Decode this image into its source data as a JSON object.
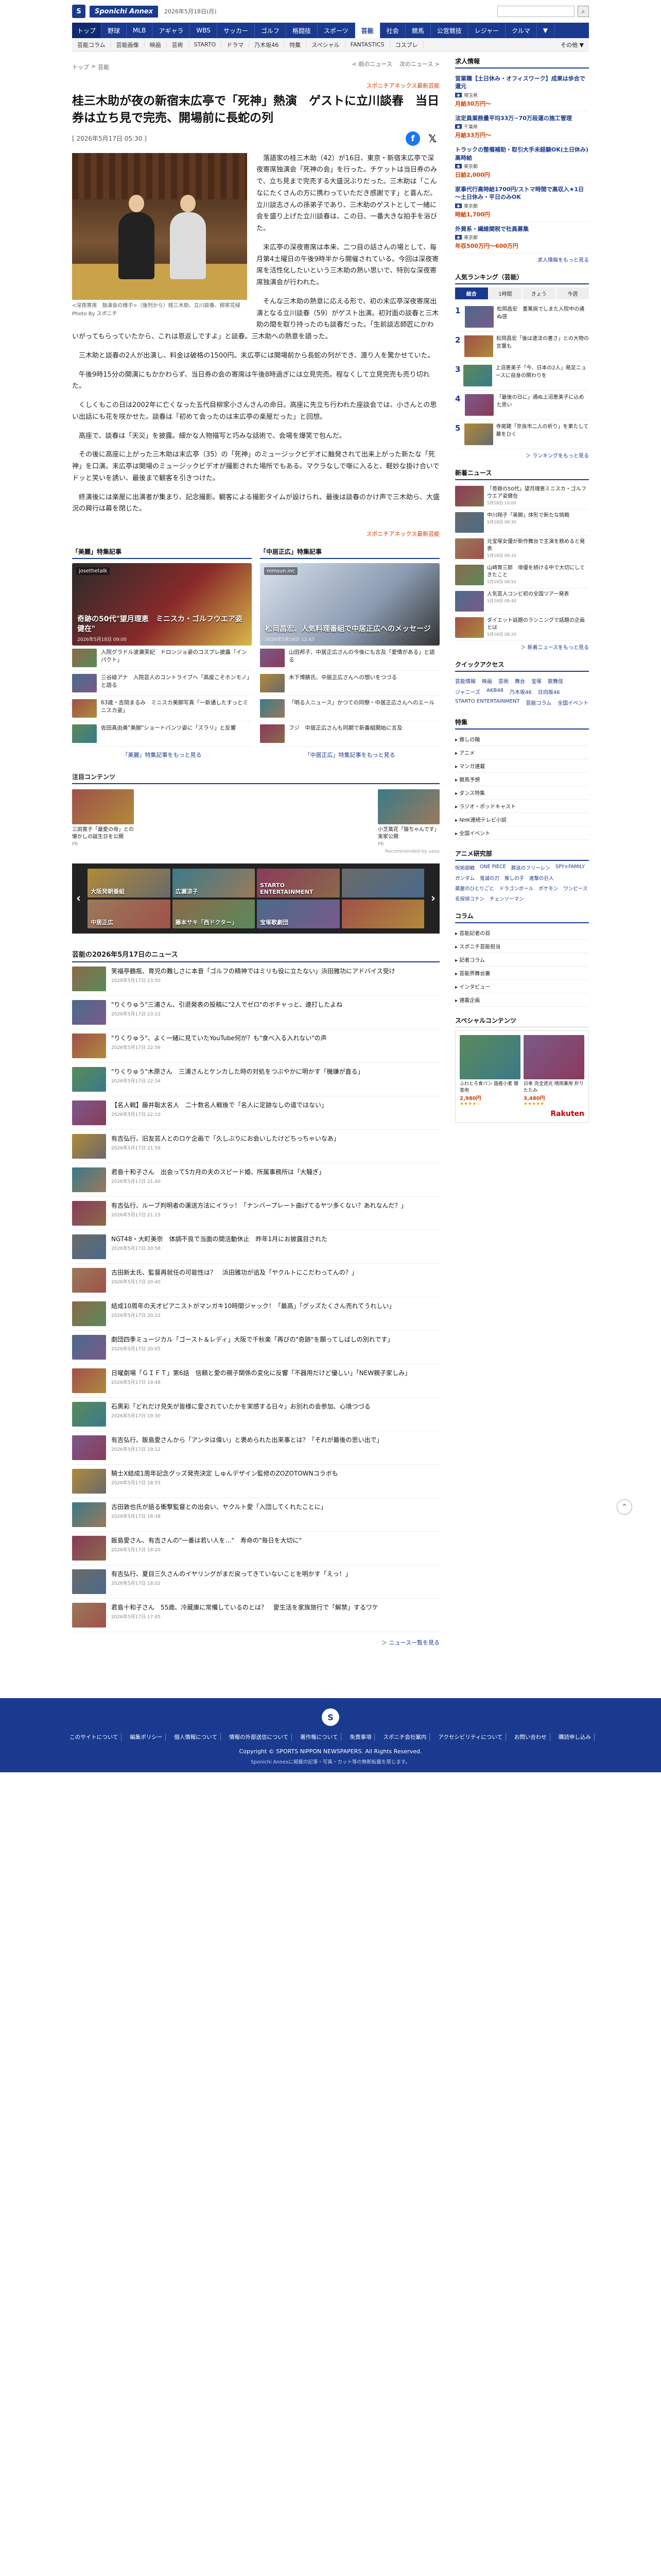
{
  "header": {
    "logo_mark": "S",
    "logo_text": "Sponichi Annex",
    "date": "2026年5月18日(月)",
    "search_placeholder": "",
    "search_icon": "search-icon"
  },
  "nav_main": [
    "トップ",
    "野球",
    "MLB",
    "アギャラ",
    "WBS",
    "サッカー",
    "ゴルフ",
    "格闘技",
    "スポーツ",
    "芸能",
    "社会",
    "競馬",
    "公営競技",
    "レジャー",
    "クルマ",
    "▼"
  ],
  "nav_main_active": 9,
  "nav_sub": [
    "芸能コラム",
    "芸能画像",
    "映画",
    "芸術",
    "STARTO",
    "ドラマ",
    "乃木坂46",
    "特集",
    "スペシャル",
    "FANTASTICS",
    "コスプレ"
  ],
  "nav_sub_more": "その他 ▼",
  "breadcrumb": [
    "トップ",
    ">",
    "芸能"
  ],
  "pager": {
    "prev": "< 前のニュース",
    "next": "次のニュース >"
  },
  "article": {
    "source": "スポニチアネックス最新芸能",
    "title": "桂三木助が夜の新宿末広亭で「死神」熱演　ゲストに立川談春　当日券は立ち見で完売、開場前に長蛇の列",
    "date": "[ 2026年5月17日 05:30 ]",
    "photo_caption": "<深夜寄席　独演会の様子>（後列から）桂三木助、立川談春、柳家花緑",
    "photo_credit": "Photo By スポニチ",
    "paragraphs": [
      "落語家の桂三木助（42）が16日、東京・新宿末広亭で深夜寄席独演会「死神の会」を行った。チケットは当日券のみで、立ち見まで完売する大盛況ぶりだった。三木助は「こんなにたくさんの方に携わっていただき感謝です」と喜んだ。立川談志さんの孫弟子であり、三木助のゲストとして一緒に会を盛り上げた立川談春は、この日、一番大きな拍手を浴びた。",
      "末広亭の深夜寄席は本来、二つ目の話さんの場として、毎月第4土曜日の午後9時半から開催されている。今回は深夜寄席を活性化したいという三木助の熱い思いで、特別な深夜寄席独演会が行われた。",
      "そんな三木助の熱意に応える形で、初の末広亭深夜寄席出演となる立川談春（59）がゲスト出演。初対面の談春と三木助の間を取り持ったのも談春だった。「生前談志師匠にかわいがってもらっていたから、これは恩返しですよ」と談春。三木助への熱意を語った。",
      "三木助と談春の2人が出演し、料金は破格の1500円。末広亭には開場前から長蛇の列ができ、渡り人を驚かせていた。",
      "午後9時15分の開演にもかかわらず、当日券の会の寄席は午後8時過ぎには立見完売。程なくして立見完売も売り切れた。",
      "くしくもこの日は2002年に亡くなった五代目柳家小さんさんの命日。高座に先立ち行われた座談会では、小さんとの思い出話にも花を咲かせた。談春は「初めて会ったのは末広亭の楽屋だった」と回想。",
      "高座で、談春は「天災」を披露。細かな人物描写と巧みな話術で、会場を爆笑で包んだ。",
      "その後に高座に上がった三木助は末広亭（35）の「死神」のミュージックビデオに触発されて出来上がった新たな「死神」を口演。末広亭は開場のミュージックビデオが撮影された場所でもある。マクラなしで噺に入ると、軽妙な掛け合いでドッと笑いを誘い、最後まで観客を引きつけた。",
      "終演後には楽屋に出演者が集まり、記念撮影。観客による撮影タイムが設けられ、最後は談春のかけ声で三木助ら、大盛況の興行は幕を閉じた。"
    ],
    "source_bottom": "スポニチアネックス最新芸能"
  },
  "tokushu": {
    "left_head": "「美麗」特集記事",
    "left_hero_label": "josethetalk",
    "left_hero_cap": "奇跡の50代\"望月理恵　ミニスカ・ゴルフウエア姿健在\"",
    "left_hero_time": "2026年5月18日 09:00",
    "left_items": [
      "入院グラドル波瀬芙紀　ドロンジョ姿のコスプレ披露「インパクト」",
      "三谷綾アナ　入院芸人のコントライブへ「高座こそホンモノ」と語る",
      "63歳・吉岡まるみ　ミニスカ美脚写真「一新通したすっとミニスカ姿」",
      "佐田真由美\"美脚\"ショートパンツ姿に「スラリ」と反響"
    ],
    "left_more": "「美麗」特集記事をもっと見る",
    "right_head": "「中居正広」特集記事",
    "right_hero_label": "mmsun.inc",
    "right_hero_cap": "松岡昌宏、人気料理番組で中居正広へのメッセージ",
    "right_hero_time": "2026年5月18日 12:47",
    "right_items": [
      "山田邦子、中居正広さんの今後にも言及「愛情がある」と語る",
      "木下博勝氏、中居正広さんへの想いをつづる",
      "「明る人ニュース」かつての同僚・中居正広さんへのエール",
      "フジ　中居正広さんも同期で新番組開始に言及"
    ],
    "right_more": "「中居正広」特集記事をもっと見る"
  },
  "attention": {
    "head": "注目コンテンツ",
    "cards": [
      {
        "text": "三田寛子「最愛の母」との懐かしの誕生日を公開",
        "pr": "PR"
      },
      {
        "text": "",
        "pr": ""
      },
      {
        "text": "",
        "pr": ""
      },
      {
        "text": "",
        "pr": ""
      },
      {
        "text": "小芝風花「猫ちゃんです」実家公開",
        "pr": "PR"
      }
    ],
    "ad_credit": "Recommended by uzou"
  },
  "carousel": {
    "tiles": [
      "大阪発朝番組",
      "広瀬涼子",
      "STARTO ENTERTAINMENT",
      "",
      "中居正広",
      "藤本サキ「西ドクター」",
      "宝塚歌劇団",
      ""
    ],
    "left_arrow": "‹",
    "right_arrow": "›"
  },
  "news": {
    "head": "芸能の2026年5月17日のニュース",
    "items": [
      {
        "title": "笑福亭鶴瓶、育児の難しさに本音「ゴルフの精神ではミリも役に立たない」浜田雅功にアドバイス受け",
        "date": "2026年5月17日 23:50"
      },
      {
        "title": "\"りくりゅう\"三浦さん、引退発表の投稿に\"2人でゼロ\"のボチャっと、連打したよね",
        "date": "2026年5月17日 23:22"
      },
      {
        "title": "\"りくりゅう\"、よく一緒に見ていたYouTube何が？も\"食べ入る入れない\"の声",
        "date": "2026年5月17日 22:56"
      },
      {
        "title": "\"りくりゅう\"木原さん　三浦さんとケンカした時の対処をつぶやかに明かす「機嫌が直る」",
        "date": "2026年5月17日 22:34"
      },
      {
        "title": "【名人戦】藤井聡太名人　二十数名人戦後で「名人に定跡なしの道ではない」",
        "date": "2026年5月17日 22:10"
      },
      {
        "title": "有吉弘行、旧友芸人とのロケ企画で「久しぶりにお会いしたけどちっちゃいなあ」",
        "date": "2026年5月17日 21:58"
      },
      {
        "title": "君島十和子さん　出会って5カ月の夫のスピード婚、所属事務所は「大騒ぎ」",
        "date": "2026年5月17日 21:40"
      },
      {
        "title": "有吉弘行、ルーブ判明者の運送方法にイラッ！「ナンバープレート曲げてるヤツ多くない？あれなんだ？」",
        "date": "2026年5月17日 21:15"
      },
      {
        "title": "NGT48・大町美奈　体調不良で当面の間活動休止　昨年1月にお披露目された",
        "date": "2026年5月17日 20:58"
      },
      {
        "title": "古田新太氏、監督再就任の可能性は？　浜田雅功が追及「ヤクルトにこだわってんの？」",
        "date": "2026年5月17日 20:40"
      },
      {
        "title": "結成10周年の天才ピアニストがマンガキ10時間ジャック！「最高」「グッズたくさん売れてうれしい」",
        "date": "2026年5月17日 20:22"
      },
      {
        "title": "劇団四季ミュージカル「ゴースト＆レディ」大阪で千秋楽「再びの\"奇跡\"を願ってしばしの別れです」",
        "date": "2026年5月17日 20:05"
      },
      {
        "title": "日曜劇場「ＧＩＦＴ」第6話　信頼と愛の親子関係の変化に反響「不器用だけど優しい」「NEW親子家しみ」",
        "date": "2026年5月17日 19:48"
      },
      {
        "title": "石黒彩「どれだけ見失が皆様に愛されていたかを実感する日々」お別れの会参加、心境つづる",
        "date": "2026年5月17日 19:30"
      },
      {
        "title": "有吉弘行、飯島愛さんから「アンタは偉い」と褒められた出来事とは？「それが最後の思い出で」",
        "date": "2026年5月17日 19:12"
      },
      {
        "title": "騎士X結成1周年記念グッズ発売決定 しゅんデザイン監修のZOZOTOWNコラボも",
        "date": "2026年5月17日 18:55"
      },
      {
        "title": "古田敦也氏が語る衝撃監督との出会い、ヤクルト愛「入団してくれたことに」",
        "date": "2026年5月17日 18:38"
      },
      {
        "title": "飯島愛さん、有吉さんの\"一番は若い人を…\"　寿命の\"毎日を大切に\"",
        "date": "2026年5月17日 18:20"
      },
      {
        "title": "有吉弘行、夏目三久さんのイヤリングがまだ戻ってきていないことを明かす「えっ！」",
        "date": "2026年5月17日 18:02"
      },
      {
        "title": "君島十和子さん　55歳、冷蔵庫に常備しているのとは？　愛生活を家族旅行で「解禁」するワケ",
        "date": "2026年5月17日 17:45"
      }
    ],
    "more": "＞ ニュース一覧を見る"
  },
  "sidebar": {
    "job_head": "求人情報",
    "jobs": [
      {
        "title": "営業職【土日休み・オフィスワーク】成果は歩合で還元",
        "sub": "",
        "loc": "埼玉県",
        "pay": "月給30万円～"
      },
      {
        "title": "法定員業務量平均33万~70万段運の施工管理",
        "sub": "",
        "loc": "千葉県",
        "pay": "月給33万円～"
      },
      {
        "title": "トラックの整備補助・取引大手未経験OK(土日休み)高時給",
        "sub": "",
        "loc": "東京都",
        "pay": "日給2,000円"
      },
      {
        "title": "家事代行高時給1700円/ストマ時間で高収入★1日～土日休み・平日のみOK",
        "sub": "",
        "loc": "東京都",
        "pay": "時給1,700円"
      },
      {
        "title": "外資系・繊維関税で社員募集",
        "sub": "",
        "loc": "東京都",
        "pay": "年収500万円～600万円"
      }
    ],
    "jobs_more": "求人情報をもっと見る",
    "rank_head": "人気ランキング（芸能）",
    "rank_tabs": [
      "総合",
      "1時間",
      "きょう",
      "今週"
    ],
    "rank_items": [
      "松岡昌宏　重篤病でしまた入院中の通ぬ感",
      "松岡昌宏「後は違法の書さ」との大物の言葉も",
      "上沼恵美子「今、日本の2人」発足ニュースに自身の関わりを",
      "「最後の日に」通ぬ上沼恵美子に込めた思い",
      "寺尾聰「奈良市二人の祈り」を果たして幕をひく"
    ],
    "rank_more": "＞ ランキングをもっと見る",
    "new_head": "新着ニュース",
    "new_items": [
      {
        "text": "「奇跡の50代」望月理恵ミニスカ・ゴルフウエア姿健在",
        "date": "5月18日 10:00"
      },
      {
        "text": "中川翔子「美脚」体形で新たな挑戦",
        "date": "5月18日 09:30"
      },
      {
        "text": "元宝塚女優が新作舞台で主演を務めると発表",
        "date": "5月18日 09:10"
      },
      {
        "text": "山崎育三郎　俳優を続ける中で大切にしてきたこと",
        "date": "5月18日 08:55"
      },
      {
        "text": "人気芸人コンビ初の全国ツアー発表",
        "date": "5月18日 08:40"
      },
      {
        "text": "ダイエット話題のランニングで話題の企画とは",
        "date": "5月18日 08:20"
      }
    ],
    "new_more": "＞ 新着ニュースをもっと見る",
    "qa_head": "クイックアクセス",
    "qa_items": [
      "芸能情報",
      "映画",
      "芸術",
      "舞台",
      "宝塚",
      "歌舞伎",
      "ジャニーズ",
      "AKB48",
      "乃木坂46",
      "日向坂46",
      "STARTO ENTERTAINMENT",
      "芸能コラム",
      "全国イベント"
    ],
    "tokus_head": "特集",
    "tokus_items": [
      "推しの麺",
      "アニメ",
      "マンガ連載",
      "競馬予想",
      "ダンス特集",
      "ラジオ・ポッドキャスト",
      "NHK連続テレビ小説",
      "全国イベント"
    ],
    "anime_head": "アニメ研究部",
    "anime_items": [
      "呪術廻戦",
      "ONE PIECE",
      "葬送のフリーレン",
      "SPY×FAMILY",
      "ガンダム",
      "鬼滅の刃",
      "推しの子",
      "進撃の巨人",
      "薬屋のひとりごと",
      "ドラゴンボール",
      "ポケモン",
      "ワンピース",
      "名探偵コナン",
      "チェンソーマン"
    ],
    "column_head": "コラム",
    "column_items": [
      "芸能記者の目",
      "スポニチ芸能担当",
      "記者コラム",
      "芸能界舞台裏",
      "インタビュー",
      "連載企画"
    ],
    "sp_head": "スペシャルコンテンツ",
    "sp_cards": [
      {
        "text": "ふわとろ食パン 国産小麦 贈答用",
        "price": "2,980円",
        "stars": "★★★★☆"
      },
      {
        "text": "日傘 完全遮光 晴雨兼用 折りたたみ",
        "price": "3,480円",
        "stars": "★★★★★"
      }
    ],
    "rakuten": "Rakuten"
  },
  "footer": {
    "logo": "S",
    "links": [
      "このサイトについて",
      "編集ポリシー",
      "個人情報について",
      "情報の外部送信について",
      "著作権について",
      "免責事項",
      "スポニチ会社案内",
      "アクセシビリティについて",
      "お問い合わせ",
      "購読申し込み"
    ],
    "copyright": "Copyright © SPORTS NIPPON NEWSPAPERS. All Rights Reserved.",
    "note": "Sponichi Annexに掲載の記事・写真・カット等の無断転載を禁じます。"
  },
  "colors": {
    "brand": "#1a3a8f",
    "accent": "#d04000"
  }
}
